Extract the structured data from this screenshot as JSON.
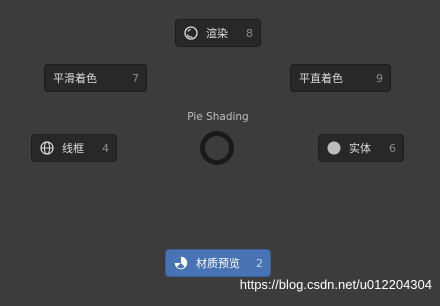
{
  "pie_menu": {
    "title": "Pie Shading",
    "items": {
      "render": {
        "label": "渲染",
        "key": "8",
        "icon": "render-sphere-icon"
      },
      "smooth": {
        "label": "平滑着色",
        "key": "7"
      },
      "flat": {
        "label": "平直着色",
        "key": "9"
      },
      "wireframe": {
        "label": "线框",
        "key": "4",
        "icon": "wireframe-globe-icon"
      },
      "solid": {
        "label": "实体",
        "key": "6",
        "icon": "solid-sphere-icon"
      },
      "material": {
        "label": "材质预览",
        "key": "2",
        "icon": "material-sphere-icon",
        "active": true
      }
    }
  },
  "watermark": "https://blog.csdn.net/u012204304",
  "colors": {
    "background": "#3c3c3c",
    "button": "#282828",
    "active": "#4772b3"
  }
}
